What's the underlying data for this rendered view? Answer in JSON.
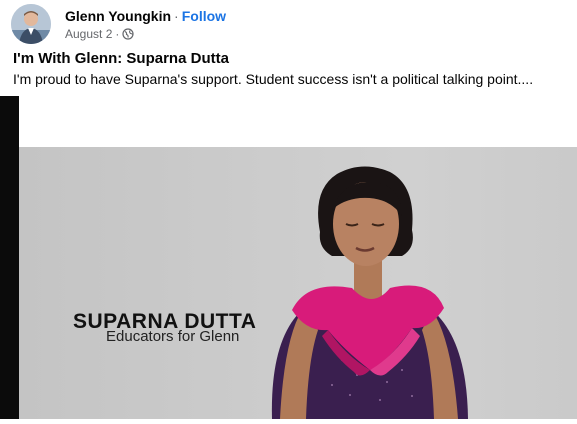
{
  "post": {
    "author": "Glenn Youngkin",
    "separator": "·",
    "follow_label": "Follow",
    "date": "August 2",
    "date_dot": "·",
    "privacy_icon": "globe-icon",
    "title": "I'm With Glenn: Suparna Dutta",
    "text": "I'm proud to have Suparna's support. Student success isn't a political talking point...."
  },
  "video": {
    "lower_third_name": "SUPARNA DUTTA",
    "lower_third_org": "Educators for Glenn"
  },
  "colors": {
    "link_blue": "#1b74e4",
    "secondary_text": "#65676b",
    "accent_scarf": "#d81b7a",
    "dress": "#3a1f4f"
  }
}
